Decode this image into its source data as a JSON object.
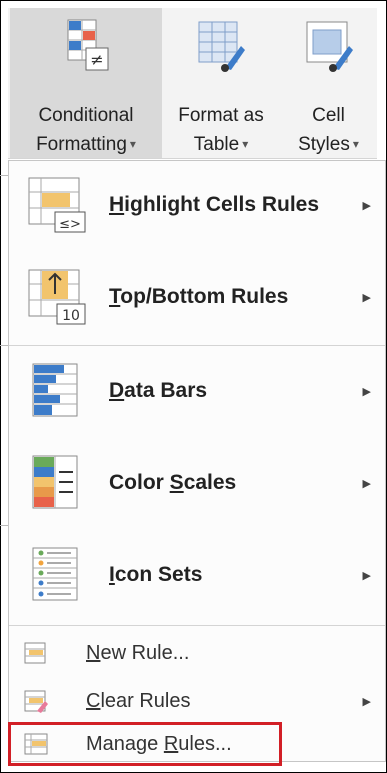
{
  "ribbon": {
    "conditional_formatting": {
      "line1": "Conditional",
      "line2": "Formatting"
    },
    "format_as_table": {
      "line1": "Format as",
      "line2": "Table"
    },
    "cell_styles": {
      "line1": "Cell",
      "line2": "Styles"
    },
    "dropdown_caret": "▾"
  },
  "menu": {
    "items": [
      {
        "label_pre": "",
        "mnemonic": "H",
        "label_post": "ighlight Cells Rules",
        "icon": "highlight-cells-icon",
        "submenu": true
      },
      {
        "label_pre": "",
        "mnemonic": "T",
        "label_post": "op/Bottom Rules",
        "icon": "top-bottom-icon",
        "submenu": true
      },
      {
        "label_pre": "",
        "mnemonic": "D",
        "label_post": "ata Bars",
        "icon": "data-bars-icon",
        "submenu": true
      },
      {
        "label_pre": "Color ",
        "mnemonic": "S",
        "label_post": "cales",
        "icon": "color-scales-icon",
        "submenu": true
      },
      {
        "label_pre": "",
        "mnemonic": "I",
        "label_post": "con Sets",
        "icon": "icon-sets-icon",
        "submenu": true
      }
    ],
    "actions": [
      {
        "label_pre": "",
        "mnemonic": "N",
        "label_post": "ew Rule...",
        "icon": "new-rule-icon",
        "submenu": false
      },
      {
        "label_pre": "",
        "mnemonic": "C",
        "label_post": "lear Rules",
        "icon": "clear-rules-icon",
        "submenu": true
      },
      {
        "label_pre": "Manage ",
        "mnemonic": "R",
        "label_post": "ules...",
        "icon": "manage-rules-icon",
        "submenu": false,
        "highlighted": true
      }
    ],
    "submenu_arrow": "▶",
    "icon_texts": {
      "top_bottom": "10",
      "highlight_sym": "≤>"
    }
  },
  "colors": {
    "highlight_border": "#d21f26",
    "blue": "#3d7cc9",
    "orange": "#f2c46d",
    "red": "#e8624a",
    "green": "#6aaa5a"
  }
}
